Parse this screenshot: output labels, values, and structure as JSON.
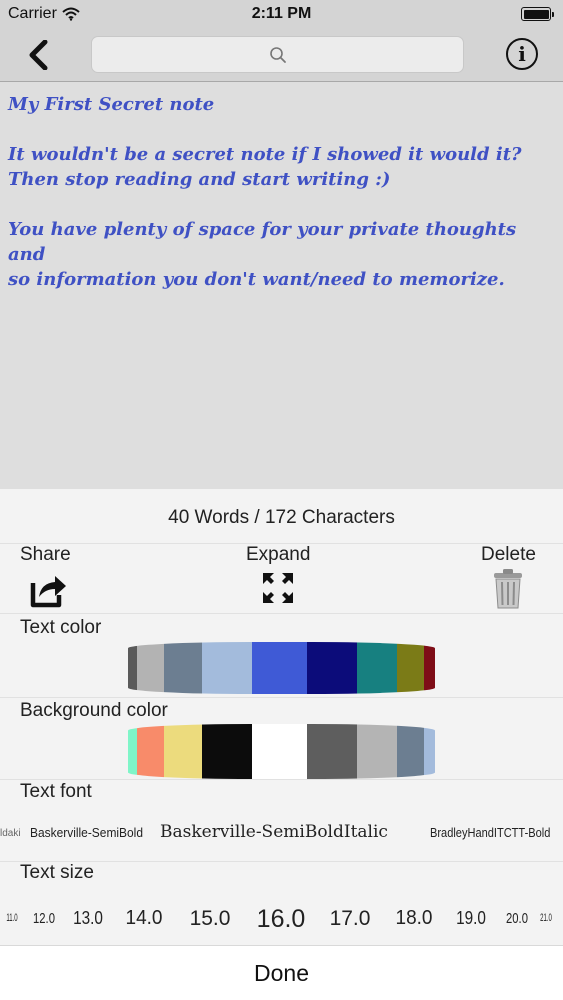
{
  "status": {
    "carrier": "Carrier",
    "time": "2:11 PM",
    "battery_level": 1.0
  },
  "nav": {
    "back_icon": "chevron-left-icon",
    "search_icon": "search-icon",
    "info_icon": "info-icon",
    "info_label": "i"
  },
  "note": {
    "lines": [
      "My First Secret note",
      "",
      "It wouldn't be a secret note if I showed it would it?",
      "Then stop reading and start writing :)",
      "",
      "You have plenty of space for your private thoughts and",
      "so information you don't want/need to memorize."
    ],
    "text_color": "#3f51c4",
    "background_color": "#dedede"
  },
  "stats": {
    "count_text": "40 Words / 172 Characters"
  },
  "actions": {
    "share_label": "Share",
    "expand_label": "Expand",
    "delete_label": "Delete"
  },
  "text_color": {
    "label": "Text color",
    "swatches": [
      "#5a5a5a",
      "#b3b3b3",
      "#6c7e91",
      "#a3bbdc",
      "#3f5ad6",
      "#0c0c7a",
      "#178080",
      "#7b7b17",
      "#7e0d17"
    ]
  },
  "background_color": {
    "label": "Background color",
    "swatches": [
      "#7ff5c8",
      "#f88b6a",
      "#ecdb7d",
      "#0c0c0c",
      "#ffffff",
      "#5e5e5e",
      "#b4b4b4",
      "#6c7e91",
      "#a3bbdc"
    ]
  },
  "text_font": {
    "label": "Text font",
    "items": [
      "Baskerville-SemiBold",
      "Baskerville-SemiBoldItalic",
      "BradleyHandITCTT-Bold"
    ],
    "selected": "Baskerville-SemiBoldItalic"
  },
  "text_size": {
    "label": "Text size",
    "items": [
      "11.0",
      "12.0",
      "13.0",
      "14.0",
      "15.0",
      "16.0",
      "17.0",
      "18.0",
      "19.0",
      "20.0",
      "21.0"
    ],
    "selected": "16.0"
  },
  "done_label": "Done"
}
